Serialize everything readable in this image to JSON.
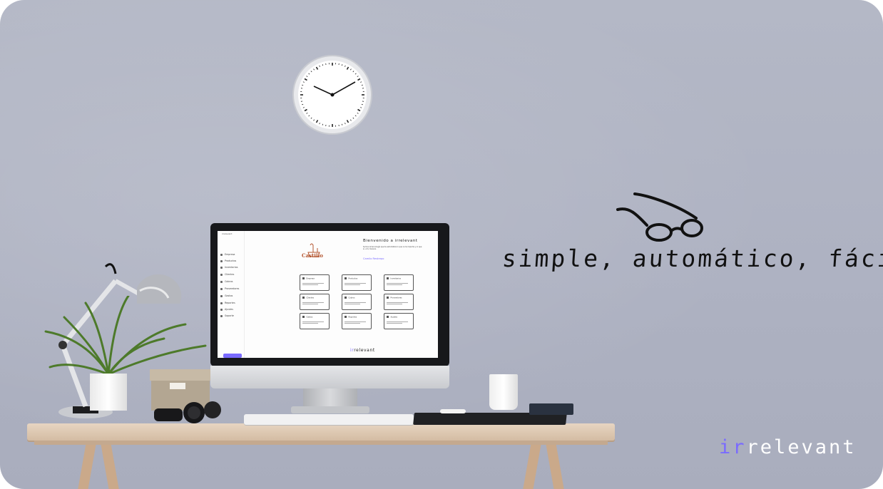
{
  "tagline": "simple, automático, fácil.",
  "brand": {
    "prefix": "ir",
    "rest": "relevant"
  },
  "colors": {
    "accent": "#7a6bff",
    "wall": "#aeb2c2",
    "desk": "#e0ccb6"
  },
  "screen": {
    "sidebar_logo": "irrelevant",
    "sidebar_items": [
      "Empresa",
      "Productos",
      "Inventarios",
      "Clientes",
      "Cobros",
      "Proveedores",
      "Gastos",
      "Reportes",
      "Ajustes",
      "Soporte"
    ],
    "logo_text": "Castillo",
    "welcome_title": "Bienvenido a irrelevant",
    "welcome_body": "Somos la tecnología que te automatiza lo que no te importa y lo que sí, a tu manera.",
    "signature": "Camilo Restrepo",
    "cards": [
      "Empresa",
      "Productos",
      "Inventarios",
      "Clientes",
      "Cobros",
      "Proveedores",
      "Gastos",
      "Reportes",
      "Ajustes"
    ],
    "brand_prefix": "ir",
    "brand_rest": "relevant"
  },
  "icons": [
    "clock-icon",
    "glasses-icon",
    "lamp-icon",
    "plant-icon",
    "headphones-icon",
    "mug-icon",
    "keyboard-icon"
  ]
}
